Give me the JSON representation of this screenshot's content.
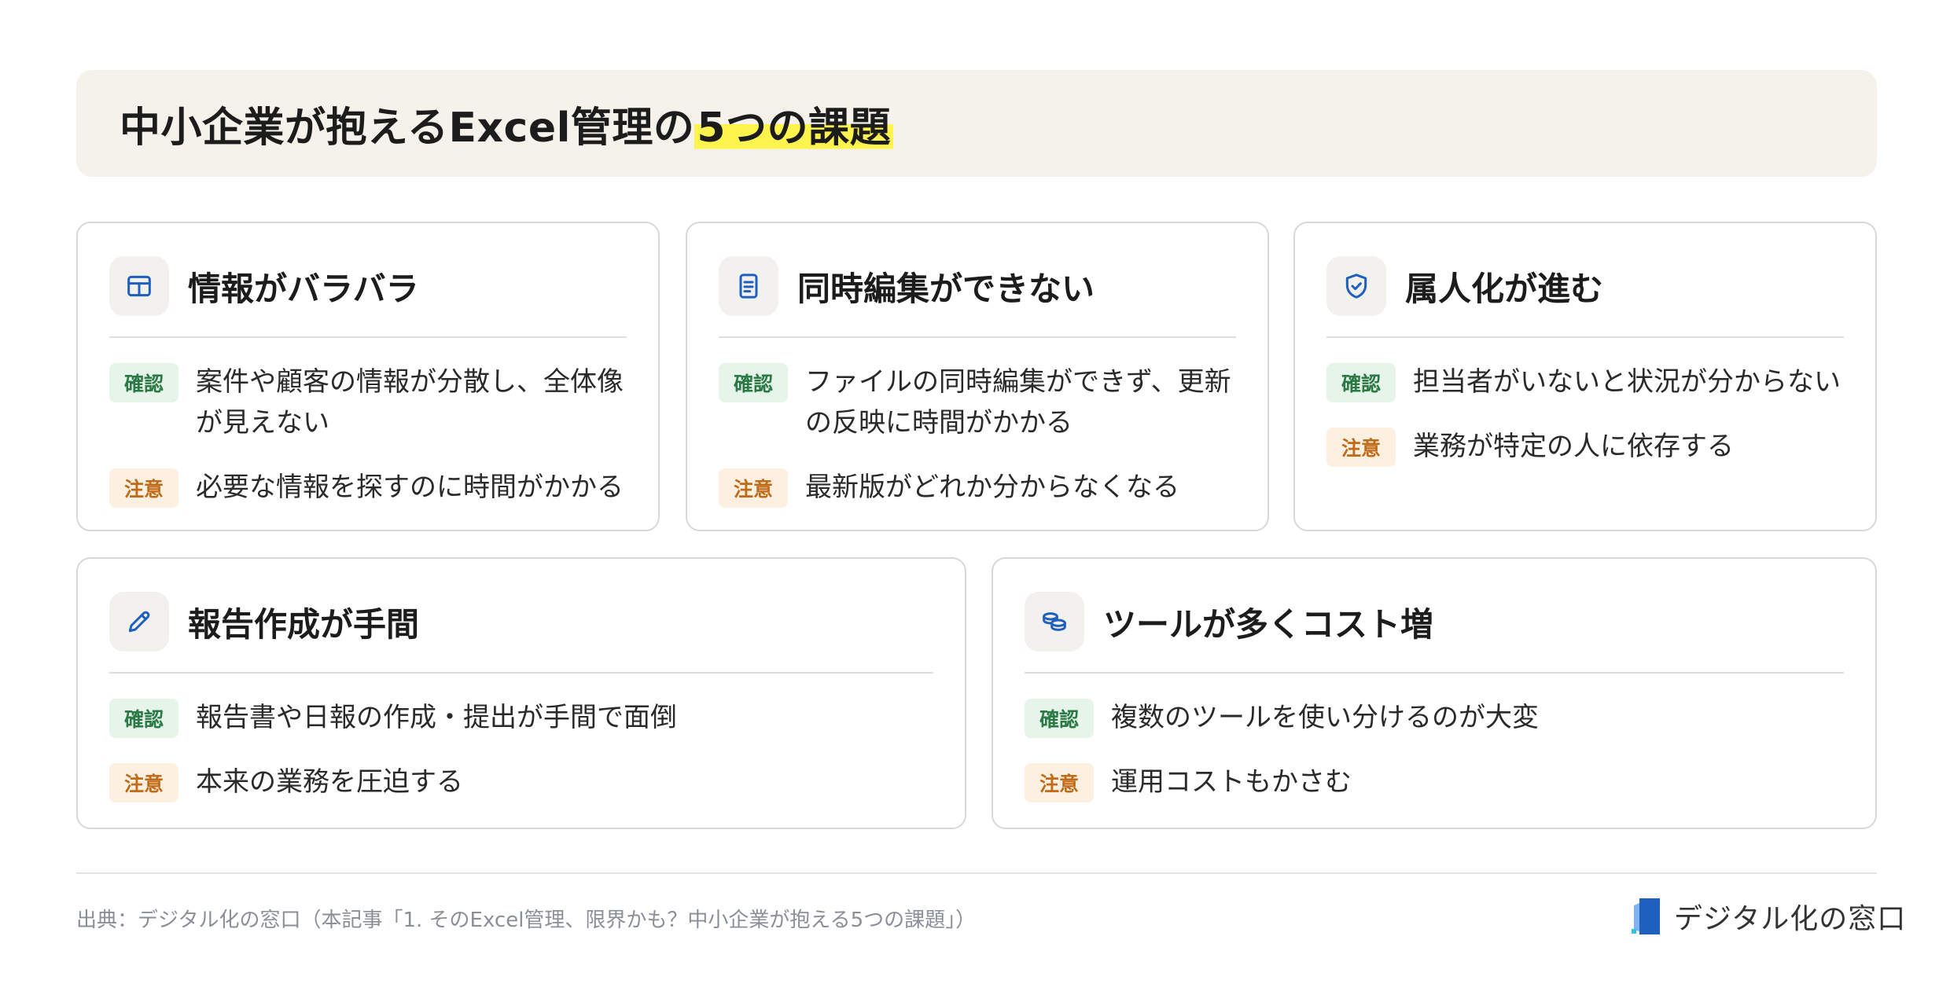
{
  "header": {
    "title_main": "中小企業が抱えるExcel管理の",
    "title_highlight": "5つの課題"
  },
  "colors": {
    "accent_blue": "#1f5fbf",
    "highlight_yellow": "#fff34d",
    "confirm_green": "#2b7a45",
    "caution_orange": "#c16a18"
  },
  "tags": {
    "confirm": "確認",
    "caution": "注意"
  },
  "cards": [
    {
      "icon": "table-icon",
      "title": "情報がバラバラ",
      "confirm_text": "案件や顧客の情報が分散し、全体像が見えない",
      "caution_text": "必要な情報を探すのに時間がかかる"
    },
    {
      "icon": "document-icon",
      "title": "同時編集ができない",
      "confirm_text": "ファイルの同時編集ができず、更新の反映に時間がかかる",
      "caution_text": "最新版がどれか分からなくなる"
    },
    {
      "icon": "shield-check-icon",
      "title": "属人化が進む",
      "confirm_text": "担当者がいないと状況が分からない",
      "caution_text": "業務が特定の人に依存する"
    },
    {
      "icon": "pencil-icon",
      "title": "報告作成が手間",
      "confirm_text": "報告書や日報の作成・提出が手間で面倒",
      "caution_text": "本来の業務を圧迫する"
    },
    {
      "icon": "coins-icon",
      "title": "ツールが多くコスト増",
      "confirm_text": "複数のツールを使い分けるのが大変",
      "caution_text": "運用コストもかさむ"
    }
  ],
  "footer": {
    "source": "出典：デジタル化の窓口（本記事「1. そのExcel管理、限界かも？中小企業が抱える5つの課題」）",
    "brand": "デジタル化の窓口"
  }
}
